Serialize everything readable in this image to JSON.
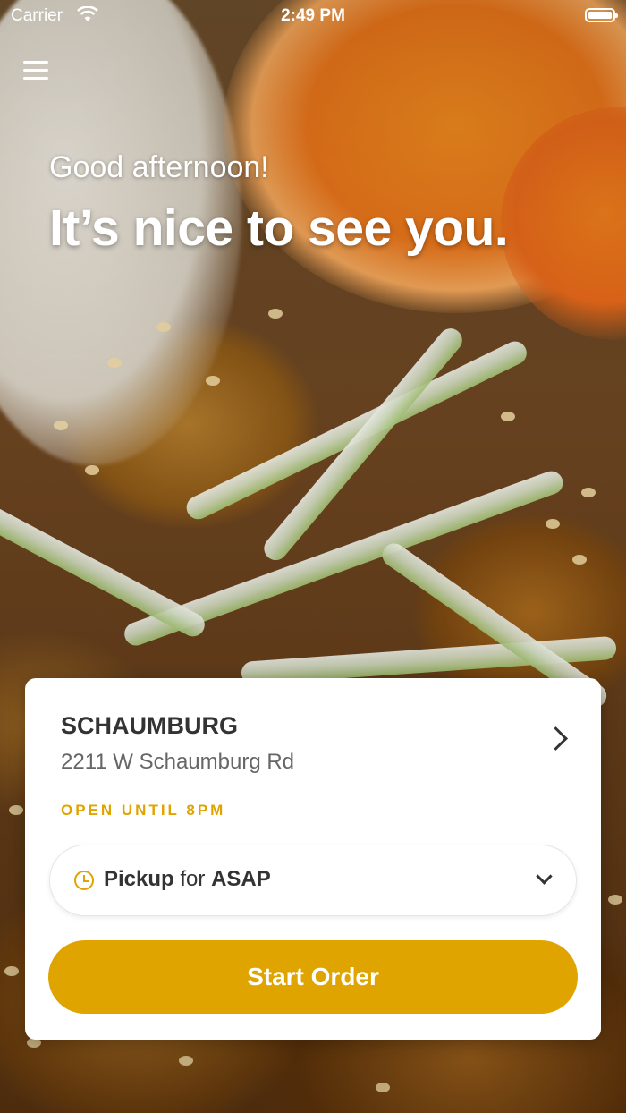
{
  "status_bar": {
    "carrier": "Carrier",
    "time": "2:49 PM"
  },
  "header": {
    "greeting": "Good afternoon!",
    "headline": "It’s nice to see you."
  },
  "location": {
    "name": "SCHAUMBURG",
    "address": "2211 W Schaumburg Rd",
    "hours": "OPEN UNTIL 8PM"
  },
  "order_mode": {
    "mode": "Pickup",
    "connector": "for",
    "time": "ASAP"
  },
  "actions": {
    "start_order": "Start Order"
  },
  "colors": {
    "accent": "#e0a400",
    "card": "#ffffff",
    "text_dark": "#333333"
  },
  "icons": [
    "menu-icon",
    "wifi-icon",
    "battery-icon",
    "chevron-right-icon",
    "clock-icon",
    "chevron-down-icon"
  ]
}
